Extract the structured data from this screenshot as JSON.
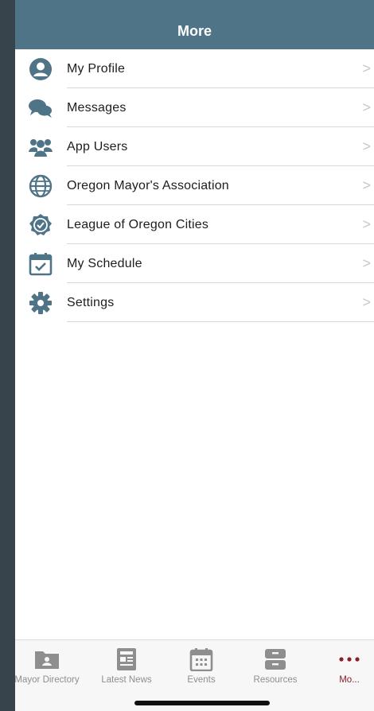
{
  "header": {
    "title": "More"
  },
  "menu": {
    "items": [
      {
        "label": "My Profile",
        "icon": "user-circle-icon"
      },
      {
        "label": "Messages",
        "icon": "chat-bubbles-icon"
      },
      {
        "label": "App Users",
        "icon": "users-group-icon"
      },
      {
        "label": "Oregon Mayor's Association",
        "icon": "globe-icon"
      },
      {
        "label": "League of Oregon Cities",
        "icon": "badge-check-icon"
      },
      {
        "label": "My Schedule",
        "icon": "calendar-check-icon"
      },
      {
        "label": "Settings",
        "icon": "gear-icon"
      }
    ],
    "chevron": ">"
  },
  "tabbar": {
    "tabs": [
      {
        "label": "Mayor Directory",
        "icon": "folder-person-icon"
      },
      {
        "label": "Latest News",
        "icon": "newspaper-icon"
      },
      {
        "label": "Events",
        "icon": "calendar-icon"
      },
      {
        "label": "Resources",
        "icon": "archive-icon"
      },
      {
        "label": "Mo...",
        "icon": "more-dots-icon",
        "active": true
      }
    ]
  },
  "colors": {
    "navbar": "#4f7387",
    "icon": "#4f7387",
    "tab_inactive": "#8e8e8e",
    "tab_active": "#8a1f2b"
  }
}
